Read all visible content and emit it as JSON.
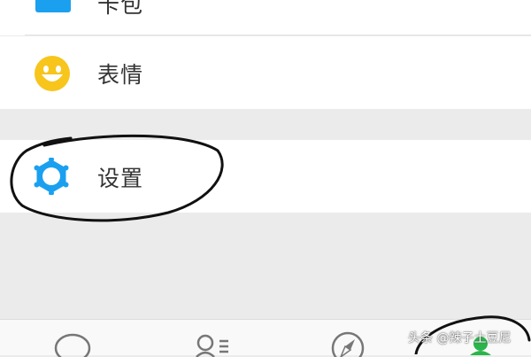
{
  "menu": {
    "card_label": "卡包",
    "emoji_label": "表情",
    "settings_label": "设置"
  },
  "icons": {
    "card": "card-icon",
    "emoji": "smiley-face-icon",
    "settings": "gear-icon",
    "tab_chats": "chat-bubble-icon",
    "tab_contacts": "contacts-icon",
    "tab_discover": "compass-icon",
    "tab_me": "person-icon"
  },
  "colors": {
    "accent_blue": "#1ba0f0",
    "emoji_yellow": "#f7c51c",
    "me_tab_green": "#2ab54a",
    "background_gray": "#ebebeb"
  },
  "watermark": "头条 @辣子土豆尼"
}
